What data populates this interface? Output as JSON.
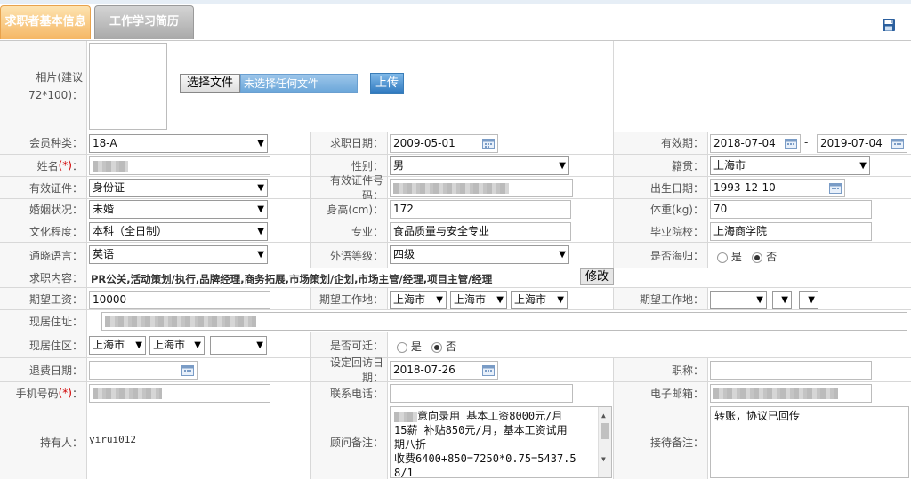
{
  "tabs": [
    {
      "label": "求职者基本信息"
    },
    {
      "label": "工作学习简历"
    }
  ],
  "photo": {
    "label": "相片(建议72*100)：",
    "choose_button": "选择文件",
    "no_file": "未选择任何文件",
    "upload_button": "上传"
  },
  "form": {
    "member_type": {
      "label": "会员种类：",
      "value": "18-A"
    },
    "apply_date": {
      "label": "求职日期：",
      "value": "2009-05-01"
    },
    "validity": {
      "label": "有效期：",
      "from": "2018-07-04",
      "sep": "-",
      "to": "2019-07-04"
    },
    "name": {
      "label": "姓名",
      "req": "(*)",
      "colon": "："
    },
    "gender": {
      "label": "性别：",
      "value": "男"
    },
    "native": {
      "label": "籍贯：",
      "value": "上海市"
    },
    "id_type": {
      "label": "有效证件：",
      "value": "身份证"
    },
    "id_no": {
      "label": "有效证件号码："
    },
    "birth": {
      "label": "出生日期：",
      "value": "1993-12-10"
    },
    "marital": {
      "label": "婚姻状况：",
      "value": "未婚"
    },
    "height": {
      "label": "身高(cm)：",
      "value": "172"
    },
    "weight": {
      "label": "体重(kg)：",
      "value": "70"
    },
    "education": {
      "label": "文化程度：",
      "value": "本科（全日制）"
    },
    "major": {
      "label": "专业：",
      "value": "食品质量与安全专业"
    },
    "school": {
      "label": "毕业院校：",
      "value": "上海商学院"
    },
    "language": {
      "label": "通晓语言：",
      "value": "英语"
    },
    "lang_level": {
      "label": "外语等级：",
      "value": "四级"
    },
    "returnee": {
      "label": "是否海归：",
      "yes": "是",
      "no": "否"
    },
    "job_content": {
      "label": "求职内容：",
      "value": "PR公关,活动策划/执行,品牌经理,商务拓展,市场策划/企划,市场主管/经理,项目主管/经理",
      "edit_button": "修改"
    },
    "salary": {
      "label": "期望工资：",
      "value": "10000"
    },
    "work_place": {
      "label": "期望工作地：",
      "v1": "上海市",
      "v2": "上海市",
      "v3": "上海市"
    },
    "work_place2": {
      "label": "期望工作地："
    },
    "address": {
      "label": "现居住址："
    },
    "district": {
      "label": "现居住区：",
      "v1": "上海市",
      "v2": "上海市"
    },
    "relocate": {
      "label": "是否可迁：",
      "yes": "是",
      "no": "否"
    },
    "refund_date": {
      "label": "退费日期："
    },
    "revisit_date": {
      "label": "设定回访日期：",
      "value": "2018-07-26"
    },
    "title": {
      "label": "职称："
    },
    "mobile": {
      "label": "手机号码",
      "req": "(*)",
      "colon": "："
    },
    "phone": {
      "label": "联系电话："
    },
    "email": {
      "label": "电子邮箱："
    },
    "holder": {
      "label": "持有人：",
      "value": "yirui012"
    },
    "advisor_note": {
      "label": "顾问备注：",
      "line1": "意向录用  基本工资8000元/月",
      "line2": "15薪  补贴850元/月，基本工资试用",
      "line3": "期八折",
      "line4": "收费6400+850=7250*0.75=5437.5",
      "line5": "8/1"
    },
    "reception_note": {
      "label": "接待备注：",
      "value": "转账，协议已回传"
    }
  },
  "colors": {
    "active_tab": "#f5b765",
    "inactive_tab": "#a9a9a9",
    "upload": "#2f79bf",
    "required": "#d00000"
  }
}
